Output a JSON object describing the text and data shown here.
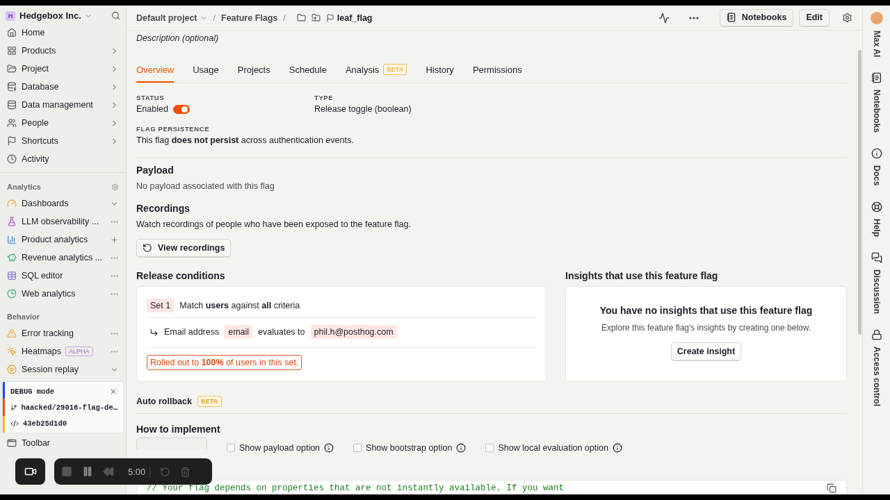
{
  "sidebar": {
    "org_initial": "H",
    "org": "Hedgebox Inc.",
    "nav": [
      {
        "label": "Home",
        "kind": "plain"
      },
      {
        "label": "Products",
        "kind": "submenu"
      },
      {
        "label": "Project",
        "kind": "submenu"
      },
      {
        "label": "Database",
        "kind": "submenu"
      },
      {
        "label": "Data management",
        "kind": "submenu"
      },
      {
        "label": "People",
        "kind": "submenu"
      },
      {
        "label": "Shortcuts",
        "kind": "submenu"
      },
      {
        "label": "Activity",
        "kind": "plain"
      }
    ],
    "sections": [
      {
        "title": "Analytics",
        "items": [
          {
            "label": "Dashboards",
            "kind": "expandable"
          },
          {
            "label": "LLM observability ...",
            "kind": "menu"
          },
          {
            "label": "Product analytics",
            "kind": "addable"
          },
          {
            "label": "Revenue analytics ...",
            "kind": "menu"
          },
          {
            "label": "SQL editor",
            "kind": "menu"
          },
          {
            "label": "Web analytics",
            "kind": "menu"
          }
        ]
      },
      {
        "title": "Behavior",
        "items": [
          {
            "label": "Error tracking",
            "kind": "menu"
          },
          {
            "label": "Heatmaps",
            "badge": "ALPHA",
            "kind": "menu"
          },
          {
            "label": "Session replay",
            "kind": "expandable"
          }
        ]
      }
    ],
    "debug": {
      "title": "DEBUG mode",
      "branch": "haacked/29016-flag-de…",
      "commit": "43eb25d1d0"
    },
    "bottom_items": [
      "Toolbar"
    ]
  },
  "header": {
    "breadcrumbs": [
      {
        "label": "Default project",
        "separator": "/"
      },
      {
        "label": "Feature Flags",
        "separator": "/"
      }
    ],
    "flag": "leaf_flag",
    "buttons": [
      "Notebooks",
      "Edit"
    ]
  },
  "description_placeholder": "Description (optional)",
  "tabs": [
    {
      "label": "Overview",
      "selected": true
    },
    {
      "label": "Usage",
      "selected": false
    },
    {
      "label": "Projects",
      "selected": false
    },
    {
      "label": "Schedule",
      "selected": false
    },
    {
      "label": "Analysis",
      "badge": "BETA",
      "selected": false
    },
    {
      "label": "History",
      "selected": false
    },
    {
      "label": "Permissions",
      "selected": false
    }
  ],
  "status": {
    "label": "STATUS",
    "value": "Enabled",
    "on": true
  },
  "type": {
    "label": "TYPE",
    "value": "Release toggle (boolean)"
  },
  "persistence": {
    "label": "FLAG PERSISTENCE",
    "text": "This flag **does not persist** across authentication events."
  },
  "payload": {
    "title": "Payload",
    "text": "No payload associated with this flag"
  },
  "recordings": {
    "title": "Recordings",
    "text": "Watch recordings of people who have been exposed to the feature flag.",
    "button": "View recordings"
  },
  "release_conditions": {
    "title": "Release conditions",
    "set_label": "Set 1",
    "match": "Match **users** against **all** criteria",
    "condition": {
      "property": "Email address",
      "key": "email",
      "operator": "evaluates to",
      "value": "phil.h@posthog.com"
    },
    "rollout": "Rolled out to **100%** of users in this set."
  },
  "insights": {
    "title": "Insights that use this feature flag",
    "empty_title": "You have no insights that use this feature flag",
    "empty_text": "Explore this feature flag's insights by creating one below.",
    "button": "Create insight"
  },
  "auto_rollback": {
    "label": "Auto rollback",
    "badge": "BETA"
  },
  "implement": {
    "title": "How to implement",
    "options": [
      {
        "label": "Show payload option",
        "checked": false
      },
      {
        "label": "Show bootstrap option",
        "checked": false
      },
      {
        "label": "Show local evaluation option",
        "checked": false
      }
    ],
    "code": "// Your flag depends on properties that are not instantly available. If you want"
  },
  "recorder": {
    "time": "5:00"
  },
  "right_rail": [
    "Max AI",
    "Notebooks",
    "Docs",
    "Help",
    "Discussion",
    "Access control"
  ]
}
